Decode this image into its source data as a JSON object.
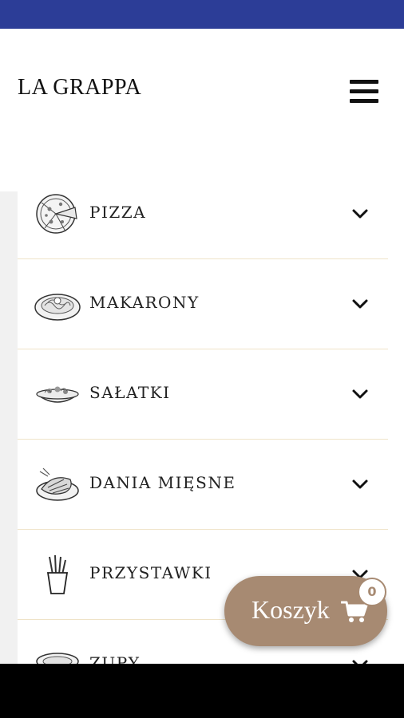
{
  "header": {
    "logo": "LA GRAPPA",
    "menu_icon": "hamburger-menu-icon"
  },
  "menu": {
    "items": [
      {
        "label": "PIZZA",
        "icon": "pizza-icon"
      },
      {
        "label": "MAKARONY",
        "icon": "pasta-plate-icon"
      },
      {
        "label": "SAŁATKI",
        "icon": "salad-bowl-icon"
      },
      {
        "label": "DANIA MIĘSNE",
        "icon": "meat-dish-icon"
      },
      {
        "label": "PRZYSTAWKI",
        "icon": "fries-icon"
      },
      {
        "label": "ZUPY",
        "icon": "soup-bowl-icon"
      }
    ],
    "chevron_icon": "chevron-down-icon"
  },
  "cart": {
    "label": "Koszyk",
    "icon": "shopping-cart-icon",
    "count": "0"
  },
  "colors": {
    "status_bar": "#2c3d97",
    "cart_button": "#a78a72",
    "divider": "#efe3c8"
  }
}
